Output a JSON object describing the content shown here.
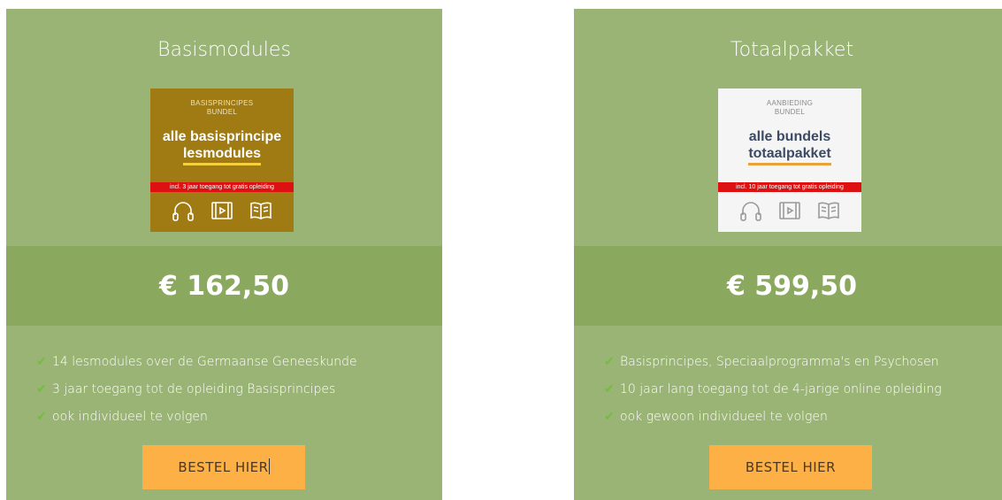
{
  "cards": [
    {
      "title": "Basismodules",
      "cover": {
        "top_line1": "BASISPRINCIPES",
        "top_line2": "BUNDEL",
        "main_line1": "alle basisprincipe",
        "main_line2": "lesmodules",
        "strip": "incl. 3 jaar toegang tot gratis opleiding",
        "icons": [
          "headphones-icon",
          "video-icon",
          "book-icon"
        ]
      },
      "price": "€ 162,50",
      "features": [
        "14 lesmodules over de Germaanse Geneeskunde",
        "3 jaar toegang tot de opleiding Basisprincipes",
        "ook individueel te volgen"
      ],
      "button_label": "BESTEL HIER"
    },
    {
      "title": "Totaalpakket",
      "cover": {
        "top_line1": "AANBIEDING",
        "top_line2": "BUNDEL",
        "main_line1": "alle bundels",
        "main_line2": "totaalpakket",
        "strip": "incl. 10 jaar toegang tot gratis opleiding",
        "icons": [
          "headphones-icon",
          "video-icon",
          "book-icon"
        ]
      },
      "price": "€ 599,50",
      "features": [
        "Basisprincipes, Speciaalprogramma's en Psychosen",
        "10 jaar lang toegang tot de 4-jarige online opleiding",
        "ook gewoon individueel te volgen"
      ],
      "button_label": "BESTEL HIER"
    }
  ],
  "colors": {
    "card_bg": "#9ab476",
    "price_band": "#8aa95e",
    "button_bg": "#fcb045",
    "check": "#6fbf3c",
    "cover_left_bg": "#a07a12",
    "cover_right_bg": "#f5f5f5",
    "strip": "#dd1111"
  }
}
